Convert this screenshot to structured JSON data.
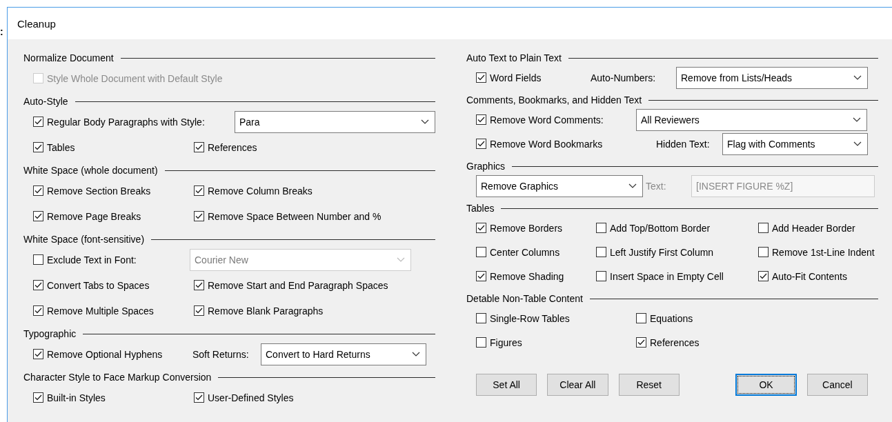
{
  "background_mark": ":",
  "window": {
    "title": "Cleanup"
  },
  "left_sections": [
    {
      "title": "Normalize Document",
      "rows": [
        [
          {
            "kind": "checkbox",
            "label": "Style Whole Document with Default Style",
            "checked": false,
            "disabled": true
          }
        ]
      ]
    },
    {
      "title": "Auto-Style",
      "rows": [
        [
          {
            "kind": "checkbox",
            "label": "Regular Body Paragraphs with Style:",
            "checked": true,
            "disabled": false
          },
          {
            "kind": "select",
            "value": "Para",
            "disabled": false
          }
        ],
        [
          {
            "kind": "checkbox",
            "label": "Tables",
            "checked": true,
            "disabled": false
          },
          {
            "kind": "checkbox",
            "label": "References",
            "checked": true,
            "disabled": false
          }
        ]
      ]
    },
    {
      "title": "White Space (whole document)",
      "rows": [
        [
          {
            "kind": "checkbox",
            "label": "Remove Section Breaks",
            "checked": true,
            "disabled": false
          },
          {
            "kind": "checkbox",
            "label": "Remove Column Breaks",
            "checked": true,
            "disabled": false
          }
        ],
        [
          {
            "kind": "checkbox",
            "label": "Remove Page Breaks",
            "checked": true,
            "disabled": false
          },
          {
            "kind": "checkbox",
            "label": "Remove Space Between Number and %",
            "checked": true,
            "disabled": false
          }
        ]
      ]
    },
    {
      "title": "White Space (font-sensitive)",
      "rows": [
        [
          {
            "kind": "checkbox",
            "label": "Exclude Text in Font:",
            "checked": false,
            "disabled": false
          },
          {
            "kind": "select",
            "value": "Courier New",
            "disabled": true
          }
        ],
        [
          {
            "kind": "checkbox",
            "label": "Convert Tabs to Spaces",
            "checked": true,
            "disabled": false
          },
          {
            "kind": "checkbox",
            "label": "Remove Start and End Paragraph Spaces",
            "checked": true,
            "disabled": false
          }
        ],
        [
          {
            "kind": "checkbox",
            "label": "Remove Multiple Spaces",
            "checked": true,
            "disabled": false
          },
          {
            "kind": "checkbox",
            "label": "Remove Blank Paragraphs",
            "checked": true,
            "disabled": false
          }
        ]
      ]
    },
    {
      "title": "Typographic",
      "rows": [
        [
          {
            "kind": "checkbox",
            "label": "Remove Optional Hyphens",
            "checked": true,
            "disabled": false
          },
          {
            "kind": "label",
            "label": "Soft Returns:",
            "disabled": false
          },
          {
            "kind": "select",
            "value": "Convert to Hard Returns",
            "disabled": false
          }
        ]
      ]
    },
    {
      "title": "Character Style to Face Markup Conversion",
      "rows": [
        [
          {
            "kind": "checkbox",
            "label": "Built-in Styles",
            "checked": true,
            "disabled": false
          },
          {
            "kind": "checkbox",
            "label": "User-Defined Styles",
            "checked": true,
            "disabled": false
          }
        ]
      ]
    }
  ],
  "right_sections": [
    {
      "title": "Auto Text to Plain Text",
      "rows": [
        [
          {
            "kind": "checkbox",
            "label": "Word Fields",
            "checked": true,
            "disabled": false
          },
          {
            "kind": "label",
            "label": "Auto-Numbers:",
            "disabled": false
          },
          {
            "kind": "select",
            "value": "Remove from Lists/Heads",
            "disabled": false
          }
        ]
      ]
    },
    {
      "title": "Comments, Bookmarks, and Hidden Text",
      "rows": [
        [
          {
            "kind": "checkbox",
            "label": "Remove Word Comments:",
            "checked": true,
            "disabled": false
          },
          {
            "kind": "select",
            "value": "All Reviewers",
            "disabled": false
          }
        ],
        [
          {
            "kind": "checkbox",
            "label": "Remove Word Bookmarks",
            "checked": true,
            "disabled": false
          },
          {
            "kind": "label",
            "label": "Hidden Text:",
            "disabled": false
          },
          {
            "kind": "select",
            "value": "Flag with Comments",
            "disabled": false
          }
        ]
      ]
    },
    {
      "title": "Graphics",
      "rows": [
        [
          {
            "kind": "select",
            "value": "Remove Graphics",
            "disabled": false
          },
          {
            "kind": "label",
            "label": "Text:",
            "disabled": true
          },
          {
            "kind": "input",
            "value": "[INSERT FIGURE %Z]",
            "disabled": true
          }
        ]
      ]
    },
    {
      "title": "Tables",
      "rows": [
        [
          {
            "kind": "checkbox",
            "label": "Remove Borders",
            "checked": true,
            "disabled": false
          },
          {
            "kind": "checkbox",
            "label": "Add Top/Bottom Border",
            "checked": false,
            "disabled": false
          },
          {
            "kind": "checkbox",
            "label": "Add Header Border",
            "checked": false,
            "disabled": false
          }
        ],
        [
          {
            "kind": "checkbox",
            "label": "Center Columns",
            "checked": false,
            "disabled": false
          },
          {
            "kind": "checkbox",
            "label": "Left Justify First Column",
            "checked": false,
            "disabled": false
          },
          {
            "kind": "checkbox",
            "label": "Remove 1st-Line Indent",
            "checked": false,
            "disabled": false
          }
        ],
        [
          {
            "kind": "checkbox",
            "label": "Remove Shading",
            "checked": true,
            "disabled": false
          },
          {
            "kind": "checkbox",
            "label": "Insert Space in Empty Cell",
            "checked": false,
            "disabled": false
          },
          {
            "kind": "checkbox",
            "label": "Auto-Fit Contents",
            "checked": true,
            "disabled": false
          }
        ]
      ]
    },
    {
      "title": "Detable Non-Table Content",
      "rows": [
        [
          {
            "kind": "checkbox",
            "label": "Single-Row Tables",
            "checked": false,
            "disabled": false
          },
          {
            "kind": "checkbox",
            "label": "Equations",
            "checked": false,
            "disabled": false
          }
        ],
        [
          {
            "kind": "checkbox",
            "label": "Figures",
            "checked": false,
            "disabled": false
          },
          {
            "kind": "checkbox",
            "label": "References",
            "checked": true,
            "disabled": false
          }
        ]
      ]
    }
  ],
  "buttons": [
    {
      "label": "Set All",
      "focused": false
    },
    {
      "label": "Clear All",
      "focused": false
    },
    {
      "label": "Reset",
      "focused": false
    },
    {
      "label": "OK",
      "focused": true
    },
    {
      "label": "Cancel",
      "focused": false
    }
  ]
}
